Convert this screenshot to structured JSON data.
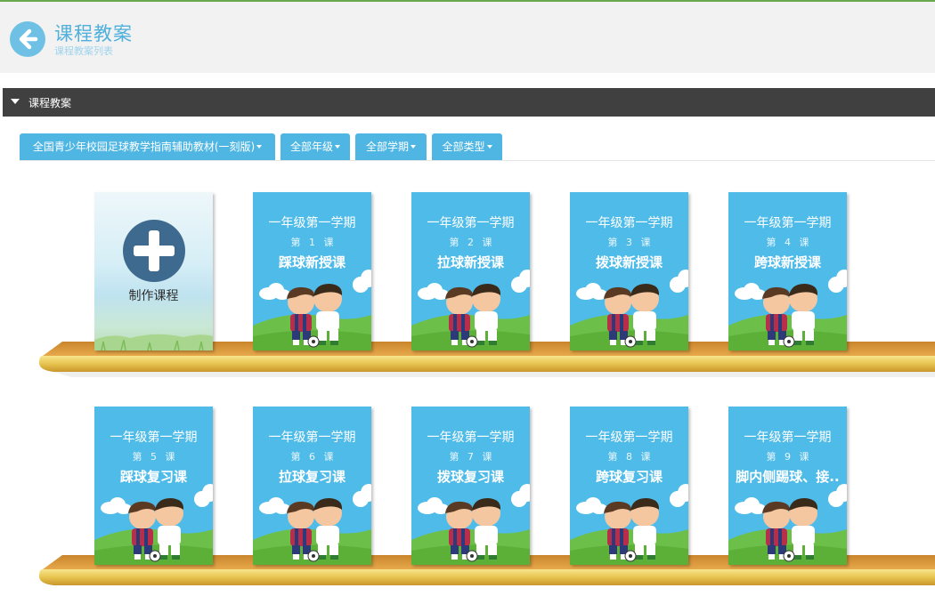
{
  "header": {
    "title": "课程教案",
    "subtitle": "课程教案列表",
    "back_icon": "arrow-left-icon"
  },
  "section": {
    "title": "课程教案"
  },
  "filters": [
    {
      "label": "全国青少年校园足球教学指南辅助教材(一刻版)"
    },
    {
      "label": "全部年级"
    },
    {
      "label": "全部学期"
    },
    {
      "label": "全部类型"
    }
  ],
  "create_card": {
    "label": "制作课程"
  },
  "lessons": [
    {
      "term": "一年级第一学期",
      "lesson_no": "第 1 课",
      "name": "踩球新授课"
    },
    {
      "term": "一年级第一学期",
      "lesson_no": "第 2 课",
      "name": "拉球新授课"
    },
    {
      "term": "一年级第一学期",
      "lesson_no": "第 3 课",
      "name": "拨球新授课"
    },
    {
      "term": "一年级第一学期",
      "lesson_no": "第 4 课",
      "name": "跨球新授课"
    },
    {
      "term": "一年级第一学期",
      "lesson_no": "第 5 课",
      "name": "踩球复习课"
    },
    {
      "term": "一年级第一学期",
      "lesson_no": "第 6 课",
      "name": "拉球复习课"
    },
    {
      "term": "一年级第一学期",
      "lesson_no": "第 7 课",
      "name": "拨球复习课"
    },
    {
      "term": "一年级第一学期",
      "lesson_no": "第 8 课",
      "name": "跨球复习课"
    },
    {
      "term": "一年级第一学期",
      "lesson_no": "第 9 课",
      "name": "脚内侧踢球、接.."
    }
  ],
  "colors": {
    "accent": "#4fb6e3",
    "card_bg": "#4fbbe9",
    "section_bar": "#404040",
    "shelf": "#e0a640"
  }
}
